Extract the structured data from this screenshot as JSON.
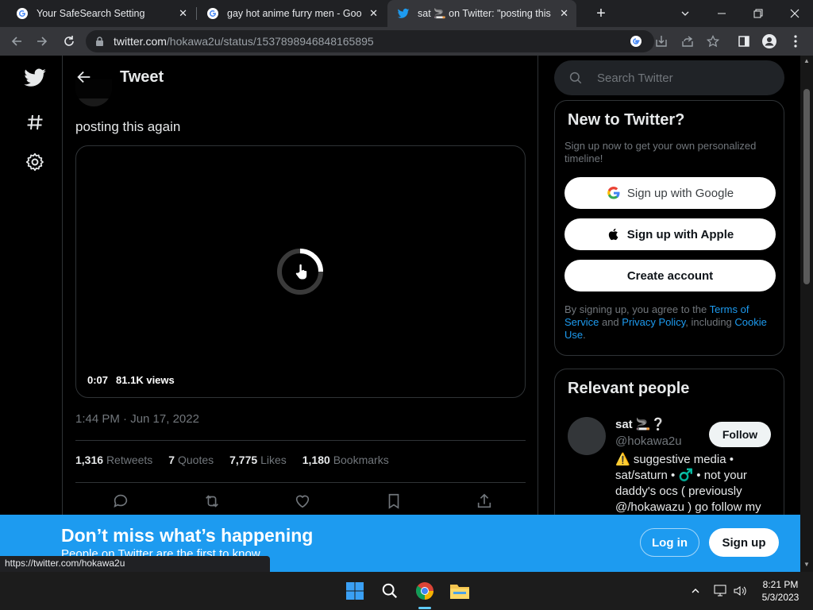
{
  "browser": {
    "tabs": [
      {
        "title": "Your SafeSearch Setting",
        "close": "✕"
      },
      {
        "title": "gay hot anime furry men - Googl",
        "close": "✕"
      },
      {
        "title": "sat 🚬 on Twitter: \"posting this a",
        "close": "✕"
      }
    ],
    "new_tab": "+",
    "url_host": "twitter.com",
    "url_path": "/hokawa2u/status/1537898946848165895"
  },
  "tweet": {
    "header_title": "Tweet",
    "text": "posting this again",
    "video_time": "0:07",
    "video_views": "81.1K views",
    "timestamp": "1:44 PM · Jun 17, 2022",
    "stats": [
      {
        "count": "1,316",
        "label": "Retweets"
      },
      {
        "count": "7",
        "label": "Quotes"
      },
      {
        "count": "7,775",
        "label": "Likes"
      },
      {
        "count": "1,180",
        "label": "Bookmarks"
      }
    ]
  },
  "sidebar": {
    "search_placeholder": "Search Twitter",
    "new_title": "New to Twitter?",
    "new_sub": "Sign up now to get your own personalized timeline!",
    "google_btn": "Sign up with Google",
    "apple_btn": "Sign up with Apple",
    "create_btn": "Create account",
    "terms_1": "By signing up, you agree to the ",
    "terms_link_1": "Terms of Service",
    "terms_2": " and ",
    "terms_link_2": "Privacy Policy",
    "terms_3": ", including ",
    "terms_link_3": "Cookie Use",
    "terms_4": ".",
    "people_title": "Relevant people",
    "person_name": "sat 🚬❔",
    "person_handle": "@hokawa2u",
    "follow_btn": "Follow",
    "person_bio": "⚠️ suggestive media • sat/saturn • ♂️ • not your daddy's ocs ( previously @/hokawazu ) go follow my"
  },
  "banner": {
    "title": "Don’t miss what’s happening",
    "subtitle": "People on Twitter are the first to know.",
    "login": "Log in",
    "signup": "Sign up"
  },
  "status_url": "https://twitter.com/hokawa2u",
  "taskbar": {
    "time": "8:21 PM",
    "date": "5/3/2023"
  },
  "colors": {
    "accent": "#1d9bf0",
    "background": "#000000",
    "muted": "#71767b"
  }
}
